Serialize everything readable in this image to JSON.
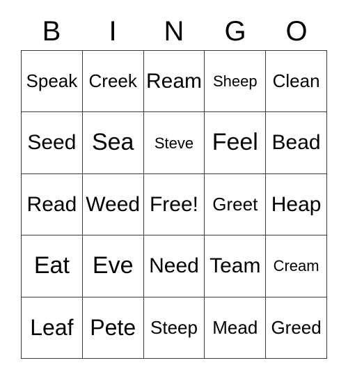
{
  "card": {
    "headers": [
      "B",
      "I",
      "N",
      "G",
      "O"
    ],
    "rows": [
      [
        {
          "text": "Speak",
          "size": "sm"
        },
        {
          "text": "Creek",
          "size": "sm"
        },
        {
          "text": "Ream",
          "size": "md"
        },
        {
          "text": "Sheep",
          "size": "xs"
        },
        {
          "text": "Clean",
          "size": "sm"
        }
      ],
      [
        {
          "text": "Seed",
          "size": "md"
        },
        {
          "text": "Sea",
          "size": "xl"
        },
        {
          "text": "Steve",
          "size": "xs"
        },
        {
          "text": "Feel",
          "size": "xl"
        },
        {
          "text": "Bead",
          "size": "md"
        }
      ],
      [
        {
          "text": "Read",
          "size": "md"
        },
        {
          "text": "Weed",
          "size": "md"
        },
        {
          "text": "Free!",
          "size": "md"
        },
        {
          "text": "Greet",
          "size": "sm"
        },
        {
          "text": "Heap",
          "size": "md"
        }
      ],
      [
        {
          "text": "Eat",
          "size": "xl"
        },
        {
          "text": "Eve",
          "size": "xl"
        },
        {
          "text": "Need",
          "size": "md"
        },
        {
          "text": "Team",
          "size": "md"
        },
        {
          "text": "Cream",
          "size": "xs"
        }
      ],
      [
        {
          "text": "Leaf",
          "size": "lg"
        },
        {
          "text": "Pete",
          "size": "lg"
        },
        {
          "text": "Steep",
          "size": "sm"
        },
        {
          "text": "Mead",
          "size": "sm"
        },
        {
          "text": "Greed",
          "size": "sm"
        }
      ]
    ],
    "free_space": "Free!",
    "colors": {
      "border": "#3a3a3a",
      "background": "#ffffff",
      "text": "#000000"
    }
  }
}
